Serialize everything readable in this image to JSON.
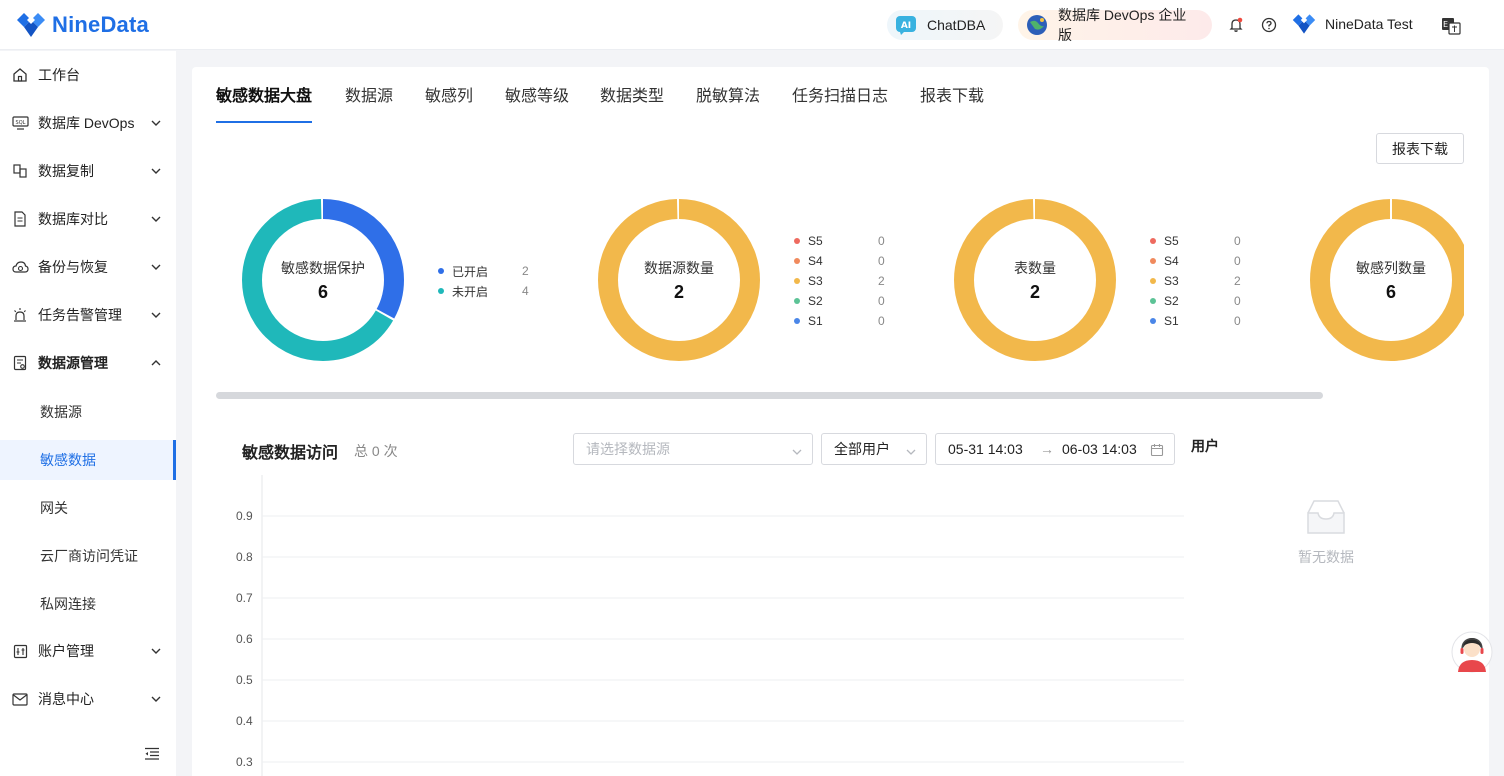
{
  "header": {
    "brand": "NineData",
    "chatdba": "ChatDBA",
    "edition": "数据库 DevOps 企业版",
    "user_name": "NineData Test"
  },
  "sidebar": {
    "items": [
      {
        "label": "工作台",
        "icon": "home-icon"
      },
      {
        "label": "数据库 DevOps",
        "icon": "sql-icon"
      },
      {
        "label": "数据复制",
        "icon": "copy-icon"
      },
      {
        "label": "数据库对比",
        "icon": "compare-icon"
      },
      {
        "label": "备份与恢复",
        "icon": "cloud-backup-icon"
      },
      {
        "label": "任务告警管理",
        "icon": "alarm-icon"
      },
      {
        "label": "数据源管理",
        "icon": "datasource-icon"
      }
    ],
    "sub_items": [
      "数据源",
      "敏感数据",
      "网关",
      "云厂商访问凭证",
      "私网连接"
    ],
    "bottom_items": [
      {
        "label": "账户管理",
        "icon": "account-icon"
      },
      {
        "label": "消息中心",
        "icon": "mail-icon"
      }
    ]
  },
  "tabs": [
    "敏感数据大盘",
    "数据源",
    "敏感列",
    "敏感等级",
    "数据类型",
    "脱敏算法",
    "任务扫描日志",
    "报表下载"
  ],
  "report_button": "报表下载",
  "summary": {
    "protection": {
      "label": "敏感数据保护",
      "total": "6",
      "legend": [
        {
          "name": "已开启",
          "value": 2,
          "color": "#2f6fe8"
        },
        {
          "name": "未开启",
          "value": 4,
          "color": "#1fb8ba"
        }
      ]
    },
    "datasource": {
      "label": "数据源数量",
      "total": "2",
      "legend": [
        {
          "name": "S5",
          "value": 0,
          "color": "#ee6a5f"
        },
        {
          "name": "S4",
          "value": 0,
          "color": "#f08a5d"
        },
        {
          "name": "S3",
          "value": 2,
          "color": "#f2b84b"
        },
        {
          "name": "S2",
          "value": 0,
          "color": "#5cc396"
        },
        {
          "name": "S1",
          "value": 0,
          "color": "#4a86e8"
        }
      ]
    },
    "tables": {
      "label": "表数量",
      "total": "2",
      "legend": [
        {
          "name": "S5",
          "value": 0,
          "color": "#ee6a5f"
        },
        {
          "name": "S4",
          "value": 0,
          "color": "#f08a5d"
        },
        {
          "name": "S3",
          "value": 2,
          "color": "#f2b84b"
        },
        {
          "name": "S2",
          "value": 0,
          "color": "#5cc396"
        },
        {
          "name": "S1",
          "value": 0,
          "color": "#4a86e8"
        }
      ]
    },
    "columns": {
      "label": "敏感列数量",
      "total": "6"
    }
  },
  "access": {
    "title": "敏感数据访问",
    "count": "总 0 次",
    "datasource_placeholder": "请选择数据源",
    "user_filter": "全部用户",
    "range_start": "05-31 14:03",
    "range_sep": "→",
    "range_end": "06-03 14:03",
    "user_title": "用户",
    "empty_text": "暂无数据"
  },
  "chart_data": {
    "type": "bar",
    "title": "",
    "xlabel": "",
    "ylabel": "",
    "y_ticks": [
      "0.9",
      "0.8",
      "0.7",
      "0.6",
      "0.5",
      "0.4",
      "0.3"
    ],
    "values": []
  }
}
